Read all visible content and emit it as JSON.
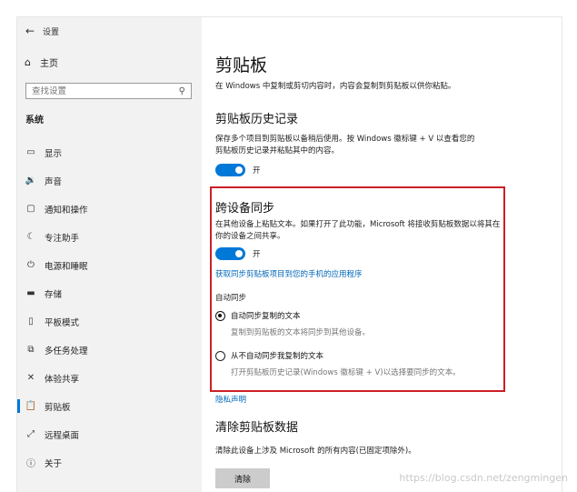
{
  "window": {
    "back_glyph": "←",
    "title": "设置"
  },
  "sidebar": {
    "home_label": "主页",
    "search_placeholder": "查找设置",
    "section": "系统",
    "items": [
      {
        "label": "显示",
        "icon": "display-icon",
        "glyph": "▭"
      },
      {
        "label": "声音",
        "icon": "sound-icon",
        "glyph": "🔉"
      },
      {
        "label": "通知和操作",
        "icon": "notification-icon",
        "glyph": "▢"
      },
      {
        "label": "专注助手",
        "icon": "focus-assist-icon",
        "glyph": "☾"
      },
      {
        "label": "电源和睡眠",
        "icon": "power-icon",
        "glyph": "⏻"
      },
      {
        "label": "存储",
        "icon": "storage-icon",
        "glyph": "▬"
      },
      {
        "label": "平板模式",
        "icon": "tablet-icon",
        "glyph": "▯"
      },
      {
        "label": "多任务处理",
        "icon": "multitasking-icon",
        "glyph": "⧉"
      },
      {
        "label": "体验共享",
        "icon": "shared-experiences-icon",
        "glyph": "✕"
      },
      {
        "label": "剪贴板",
        "icon": "clipboard-icon",
        "glyph": "📋",
        "active": true
      },
      {
        "label": "远程桌面",
        "icon": "remote-desktop-icon",
        "glyph": "⤢"
      },
      {
        "label": "关于",
        "icon": "about-icon",
        "glyph": "ⓘ"
      }
    ]
  },
  "main": {
    "title": "剪贴板",
    "description": "在 Windows 中复制或剪切内容时，内容会复制到剪贴板以供你粘贴。",
    "history": {
      "title": "剪贴板历史记录",
      "description": "保存多个项目到剪贴板以备稍后使用。按 Windows 徽标键 + V 以查看您的剪贴板历史记录并粘贴其中的内容。",
      "toggle_label": "开"
    },
    "sync": {
      "title": "跨设备同步",
      "description": "在其他设备上粘贴文本。如果打开了此功能，Microsoft 将接收剪贴板数据以将其在你的设备之间共享。",
      "toggle_label": "开",
      "link": "获取同步剪贴板项目到您的手机的应用程序",
      "auto_label": "自动同步",
      "options": [
        {
          "label": "自动同步复制的文本",
          "sub": "复制到剪贴板的文本将同步到其他设备。",
          "checked": true
        },
        {
          "label": "从不自动同步我复制的文本",
          "sub": "打开剪贴板历史记录(Windows 徽标键 + V)以选择要同步的文本。",
          "checked": false
        }
      ]
    },
    "privacy_link": "隐私声明",
    "clear": {
      "title": "清除剪贴板数据",
      "description": "清除此设备上涉及 Microsoft 的所有内容(已固定项除外)。",
      "button": "清除"
    }
  },
  "watermark": "https://blog.csdn.net/zengmingen",
  "colors": {
    "accent": "#0078d7",
    "link": "#0067b8",
    "highlight_box": "#cc1f27"
  }
}
